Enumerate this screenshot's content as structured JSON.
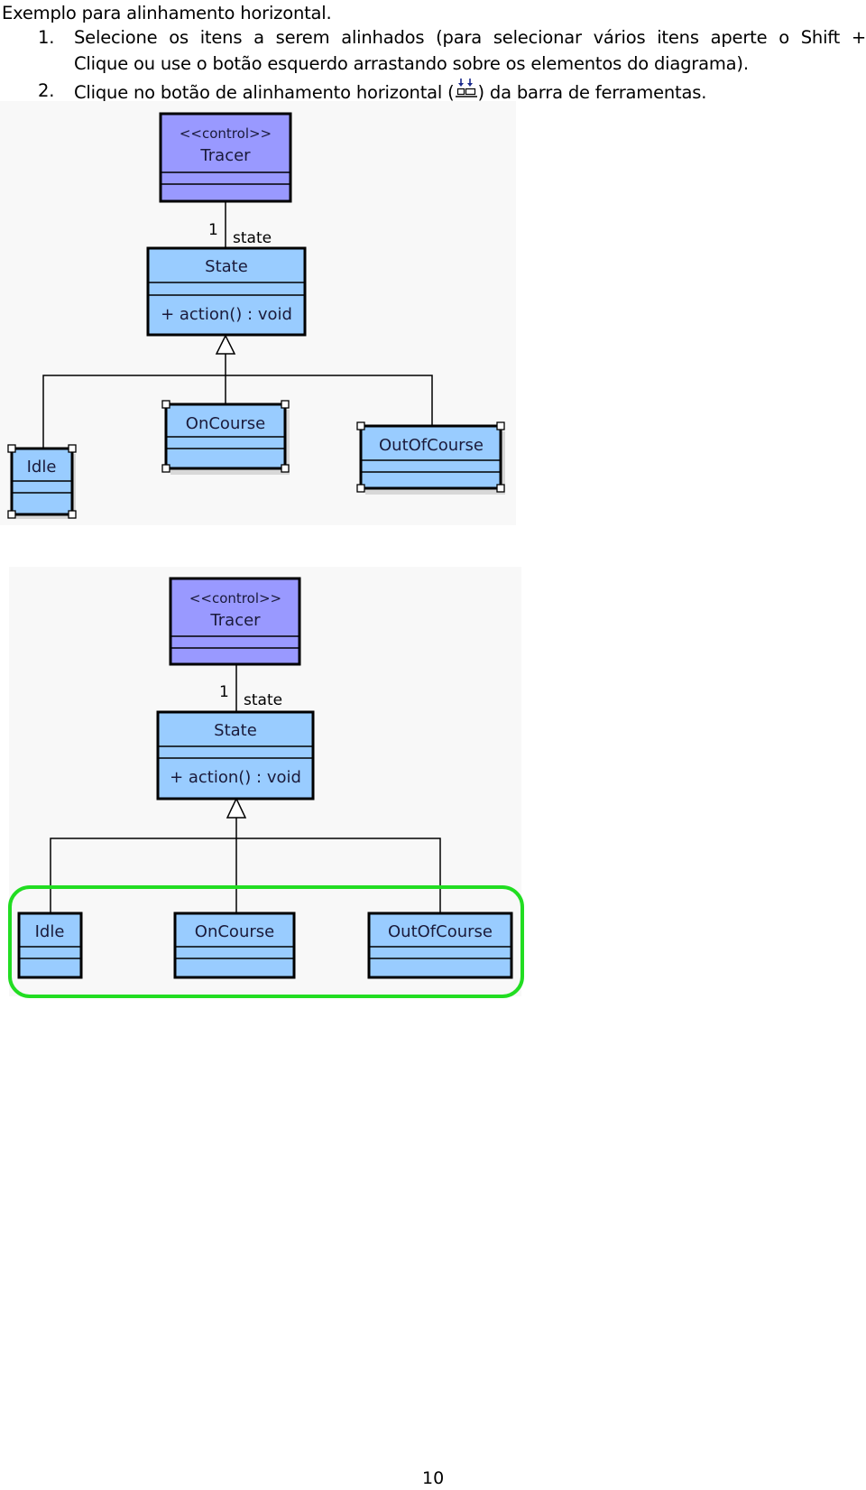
{
  "document": {
    "intro": "Exemplo para alinhamento horizontal.",
    "steps": [
      {
        "number": "1.",
        "line1_words": [
          "Selecione",
          "os",
          "itens",
          "a",
          "serem",
          "alinhados",
          "(para",
          "selecionar",
          "vários",
          "itens",
          "aperte",
          "o",
          "Shift",
          "+"
        ],
        "line2": "Clique ou use o botão esquerdo arrastando sobre os elementos do diagrama)."
      },
      {
        "number": "2.",
        "before_icon": "Clique no botão de alinhamento horizontal (",
        "icon": "align-horizontal-icon",
        "after_icon": ") da barra de ferramentas."
      }
    ],
    "page_number": "10"
  },
  "diagrams": [
    {
      "label": "before-alignment",
      "classes": {
        "tracer": {
          "stereotype": "<<control>>",
          "name": "Tracer"
        },
        "state": {
          "name": "State",
          "operation": "+ action() : void"
        },
        "idle": {
          "name": "Idle"
        },
        "oncourse": {
          "name": "OnCourse"
        },
        "outofcourse": {
          "name": "OutOfCourse"
        }
      },
      "association": {
        "multiplicity": "1",
        "role": "state"
      },
      "selected": [
        "Idle",
        "OnCourse",
        "OutOfCourse"
      ]
    },
    {
      "label": "after-alignment",
      "classes": {
        "tracer": {
          "stereotype": "<<control>>",
          "name": "Tracer"
        },
        "state": {
          "name": "State",
          "operation": "+ action() : void"
        },
        "idle": {
          "name": "Idle"
        },
        "oncourse": {
          "name": "OnCourse"
        },
        "outofcourse": {
          "name": "OutOfCourse"
        }
      },
      "association": {
        "multiplicity": "1",
        "role": "state"
      },
      "highlight": "aligned-group"
    }
  ],
  "colors": {
    "control_class_fill": "#9999ff",
    "class_fill": "#99ccff",
    "diagram_bg": "#f8f8f8",
    "highlight": "#22dd22",
    "text": "#000000"
  }
}
